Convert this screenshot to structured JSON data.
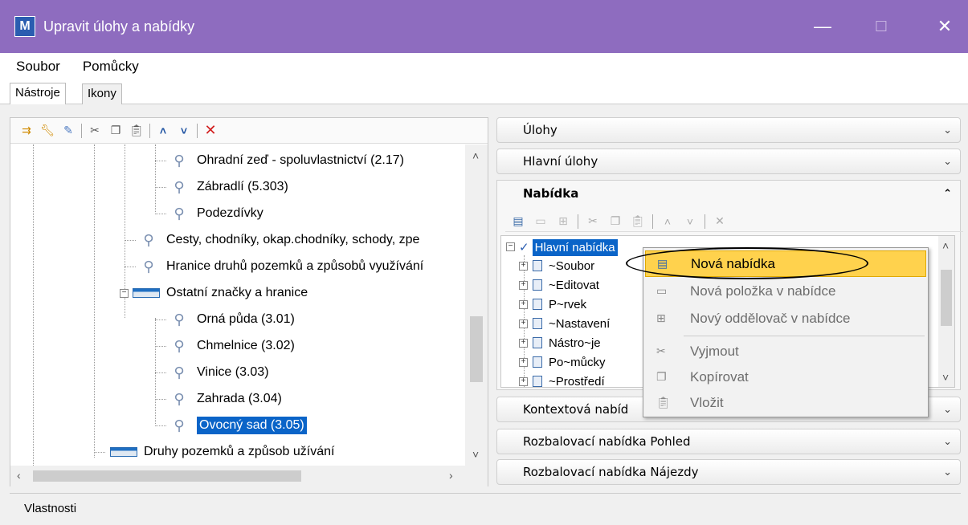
{
  "window": {
    "title": "Upravit úlohy a nabídky",
    "minimize": "—",
    "maximize": "☐",
    "close": "✕",
    "app_icon_glyph": "M"
  },
  "menubar": {
    "items": [
      "Soubor",
      "Pomůcky"
    ]
  },
  "tabs": [
    "Nástroje",
    "Ikony"
  ],
  "left_toolbar": {
    "icons": [
      "new-task-icon",
      "wrench-icon",
      "wrench-edit-icon",
      "cut-icon",
      "copy-icon",
      "paste-icon",
      "move-up-icon",
      "move-down-icon",
      "delete-icon"
    ]
  },
  "tree": {
    "items": [
      {
        "label": "Ohradní zeď - spoluvlastnictví (2.17)"
      },
      {
        "label": "Zábradlí (5.303)"
      },
      {
        "label": "Podezdívky"
      },
      {
        "label": "Cesty, chodníky, okap.chodníky, schody, zpe"
      },
      {
        "label": "Hranice druhů pozemků a způsobů využívání"
      },
      {
        "label": "Ostatní značky a hranice"
      },
      {
        "label": "Orná půda (3.01)"
      },
      {
        "label": "Chmelnice (3.02)"
      },
      {
        "label": "Vinice (3.03)"
      },
      {
        "label": "Zahrada (3.04)"
      },
      {
        "label": "Ovocný sad (3.05)"
      },
      {
        "label": "Druhy pozemků a způsob užívání"
      }
    ],
    "selected": "Ovocný sad (3.05)"
  },
  "right_panels": {
    "ulohy": "Úlohy",
    "hlavni_ulohy": "Hlavní úlohy",
    "nabidka": "Nabídka",
    "kontextova": "Kontextová nabíd",
    "pohled": "Rozbalovací nabídka Pohled",
    "najezdy": "Rozbalovací nabídka Nájezdy"
  },
  "menu_tree": {
    "root": "Hlavní nabídka",
    "children": [
      "~Soubor",
      "~Editovat",
      "P~rvek",
      "~Nastavení",
      "Nástro~je",
      "Po~můcky",
      "~Prostředí"
    ]
  },
  "context_menu": {
    "items": [
      {
        "label": "Nová nabídka",
        "enabled": true
      },
      {
        "label": "Nová položka v nabídce",
        "enabled": false
      },
      {
        "label": "Nový oddělovač v nabídce",
        "enabled": false
      },
      {
        "label": "Vyjmout",
        "enabled": false
      },
      {
        "label": "Kopírovat",
        "enabled": false
      },
      {
        "label": "Vložit",
        "enabled": false
      }
    ]
  },
  "properties": {
    "label": "Vlastnosti"
  },
  "colors": {
    "titlebar": "#8e6cbf",
    "selection": "#0a64c8",
    "highlight": "#ffd24d"
  }
}
